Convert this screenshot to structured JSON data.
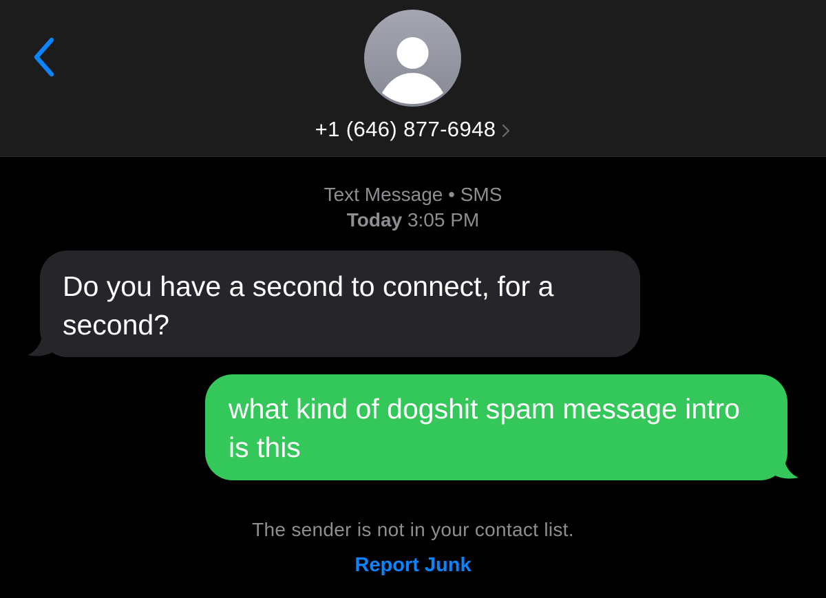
{
  "header": {
    "back_icon": "chevron-left-icon",
    "avatar_icon": "person-silhouette-icon",
    "contact_number": "+1 (646) 877-6948",
    "contact_chevron_icon": "chevron-right-icon"
  },
  "meta": {
    "service_line": "Text Message • SMS",
    "timestamp_day": "Today",
    "timestamp_time": "3:05 PM"
  },
  "messages": [
    {
      "direction": "incoming",
      "text": "Do you have a second to connect, for a second?"
    },
    {
      "direction": "outgoing",
      "text": "what kind of dogshit spam message intro is this"
    }
  ],
  "footer": {
    "notice": "The sender is not in your contact list.",
    "report_label": "Report Junk"
  },
  "colors": {
    "background": "#000000",
    "header_background": "#1c1c1d",
    "incoming_bubble": "#26252a",
    "outgoing_bubble": "#34c759",
    "accent_blue": "#0a84ff",
    "secondary_text": "#8e8e93"
  }
}
